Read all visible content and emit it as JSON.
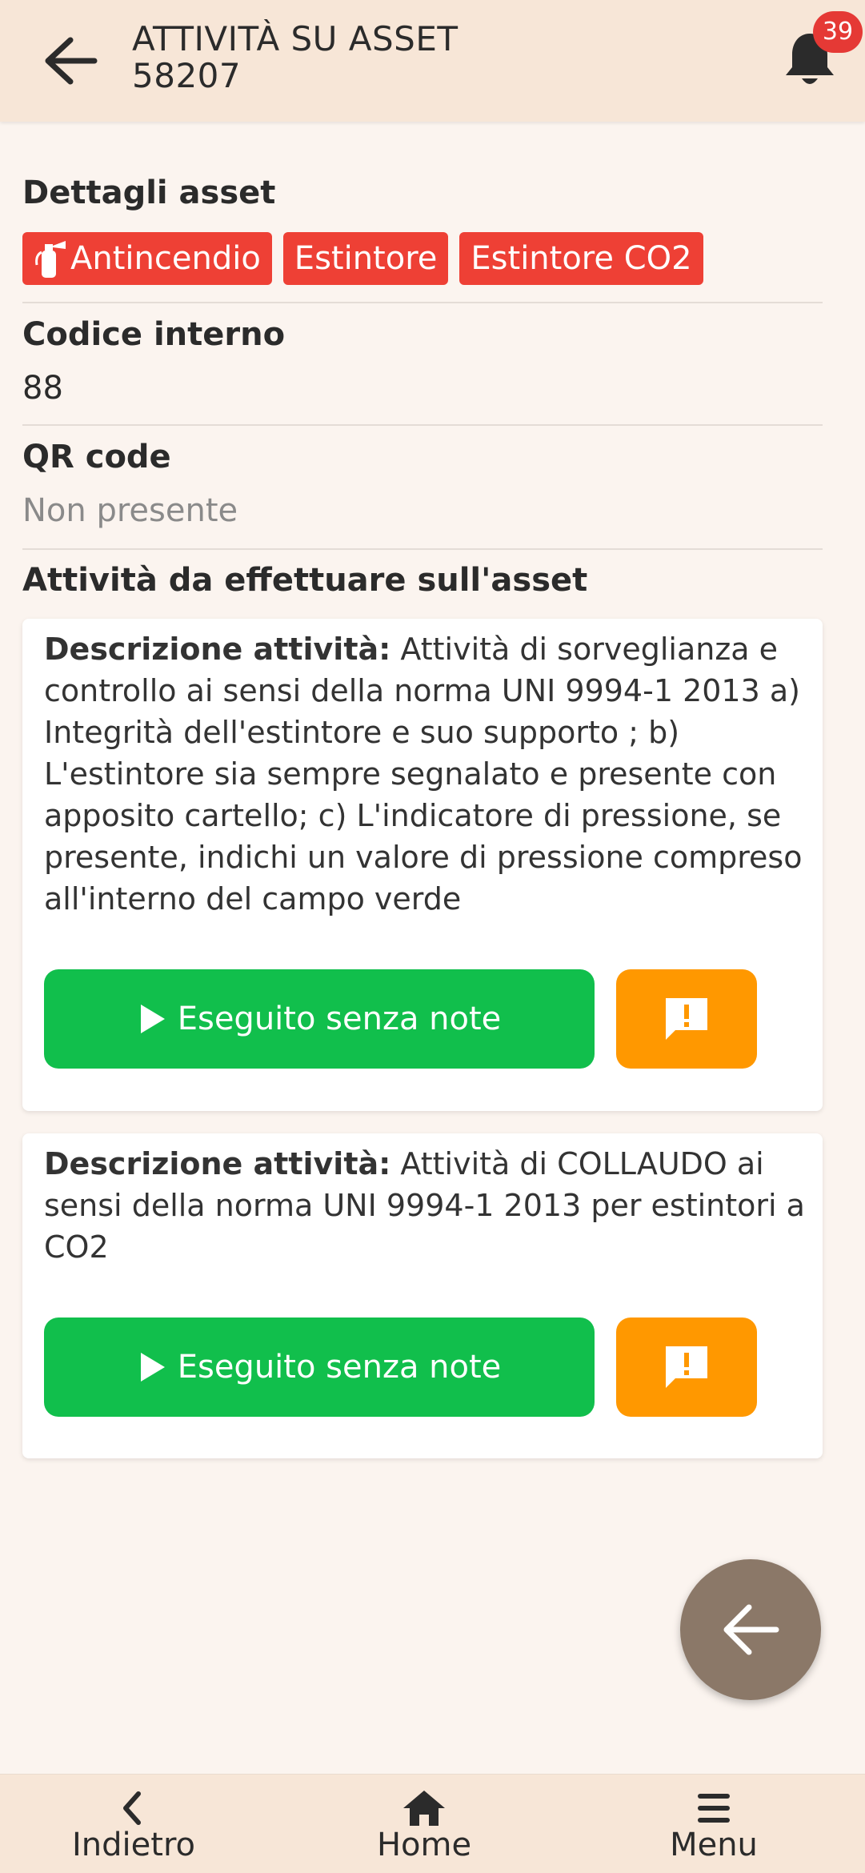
{
  "header": {
    "title_line1": "ATTIVITÀ SU ASSET",
    "title_line2": "58207",
    "notification_count": "39"
  },
  "asset": {
    "details_label": "Dettagli asset",
    "tags": [
      "Antincendio",
      "Estintore",
      "Estintore CO2"
    ],
    "internal_code_label": "Codice interno",
    "internal_code_value": "88",
    "qr_label": "QR code",
    "qr_value": "Non presente"
  },
  "activities": {
    "section_label": "Attività da effettuare sull'asset",
    "description_prefix": "Descrizione attività:",
    "items": [
      {
        "description": "Attività di sorveglianza e controllo ai sensi della norma UNI 9994-1 2013 a) Integrità dell'estintore e suo supporto ; b) L'estintore sia sempre segnalato e presente con apposito cartello; c) L'indicatore di pressione, se presente, indichi un valore di pressione compreso all'interno del campo verde",
        "done_label": "Eseguito senza note"
      },
      {
        "description": "Attività di COLLAUDO ai sensi della norma UNI 9994-1 2013 per estintori a CO2",
        "done_label": "Eseguito senza note"
      }
    ]
  },
  "bottom_nav": {
    "back_label": "Indietro",
    "home_label": "Home",
    "menu_label": "Menu"
  },
  "colors": {
    "header_bg": "#f7e6d7",
    "tag_red": "#ee4035",
    "done_green": "#11bf4c",
    "note_orange": "#ff9800",
    "fab_brown": "#8b7868"
  }
}
